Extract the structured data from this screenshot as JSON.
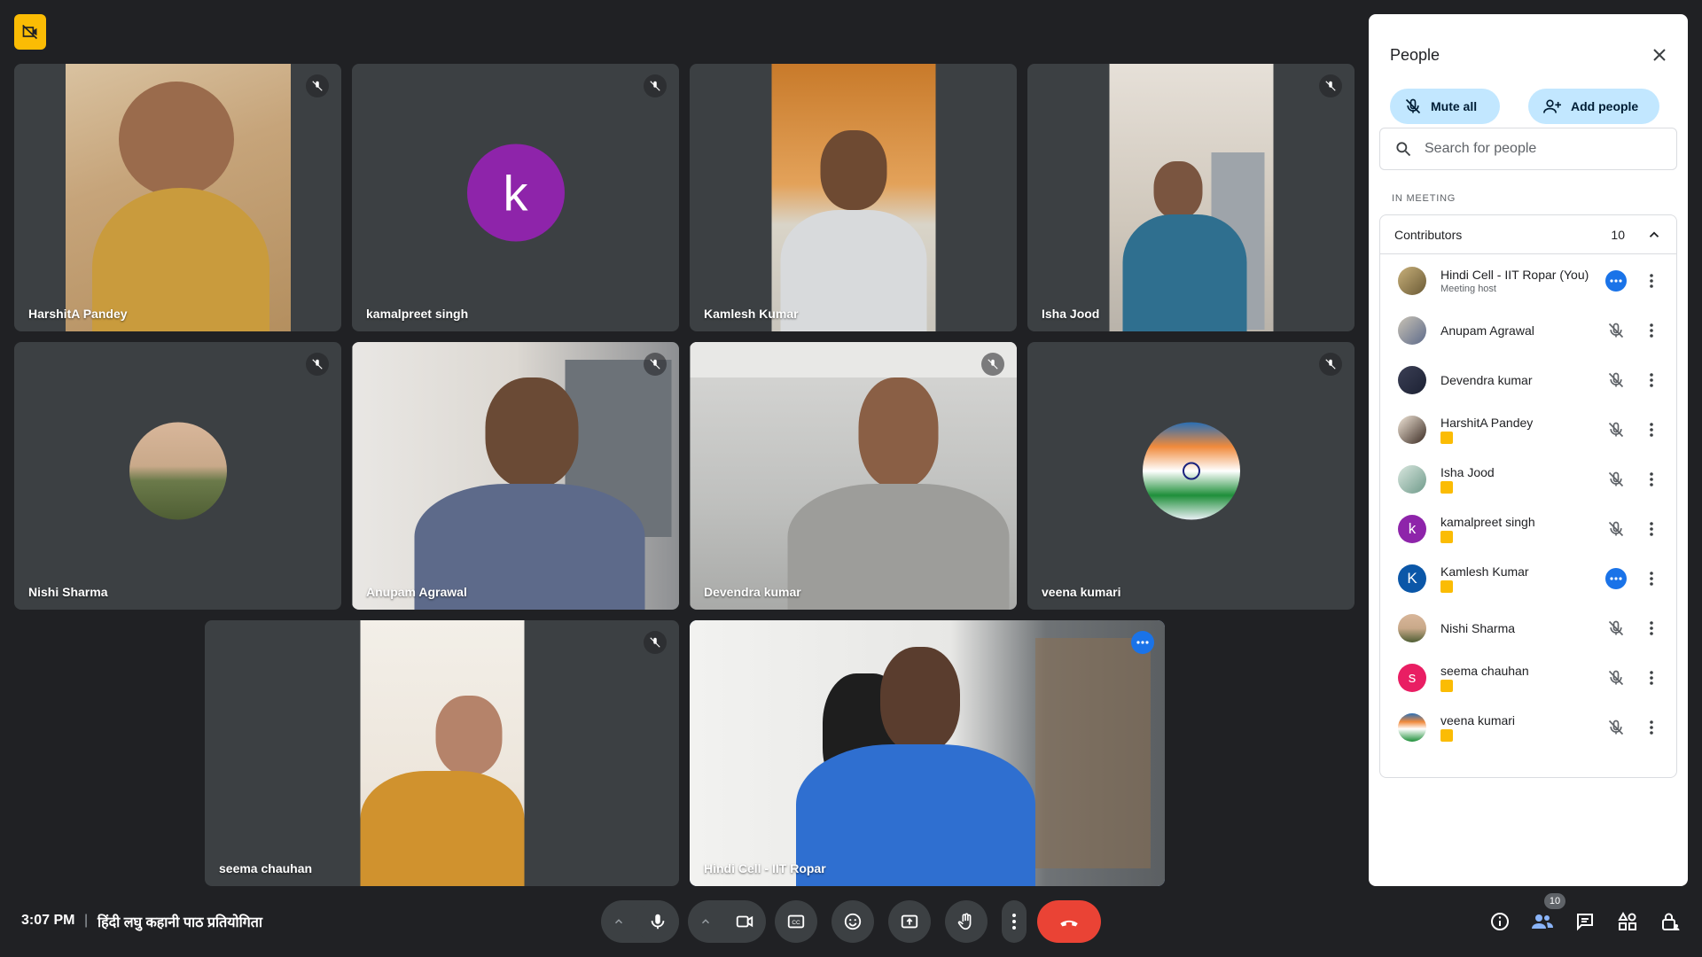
{
  "meeting": {
    "time": "3:07 PM",
    "separator": "|",
    "title": "हिंदी लघु कहानी पाठ प्रतियोगिता"
  },
  "tiles": {
    "harshita": "HarshitA Pandey",
    "kamalpreet": "kamalpreet singh",
    "kamalpreet_initial": "k",
    "kamlesh": "Kamlesh Kumar",
    "isha": "Isha Jood",
    "nishi": "Nishi Sharma",
    "anupam": "Anupam Agrawal",
    "devendra": "Devendra kumar",
    "veena": "veena kumari",
    "seema": "seema chauhan",
    "hindicell": "Hindi Cell - IIT Ropar"
  },
  "panel": {
    "title": "People",
    "mute_all": "Mute all",
    "add_people": "Add people",
    "search_placeholder": "Search for people",
    "in_meeting": "IN MEETING",
    "contributors_label": "Contributors",
    "contributors_count": "10",
    "people": [
      {
        "name": "Hindi Cell - IIT Ropar (You)",
        "sub": "Meeting host"
      },
      {
        "name": "Anupam Agrawal"
      },
      {
        "name": "Devendra kumar"
      },
      {
        "name": "HarshitA Pandey"
      },
      {
        "name": "Isha Jood"
      },
      {
        "name": "kamalpreet singh",
        "initial": "k"
      },
      {
        "name": "Kamlesh Kumar",
        "initial": "K"
      },
      {
        "name": "Nishi Sharma"
      },
      {
        "name": "seema chauhan",
        "initial": "s"
      },
      {
        "name": "veena kumari"
      }
    ]
  },
  "controls": {
    "people_count_badge": "10"
  },
  "colors": {
    "background": "#202124",
    "tile": "#3c4043",
    "accent_blue": "#1a73e8",
    "end_call_red": "#ea4335",
    "pill_blue": "#c2e7ff",
    "purple_avatar": "#8e24aa",
    "badge_yellow": "#fbbc04"
  }
}
